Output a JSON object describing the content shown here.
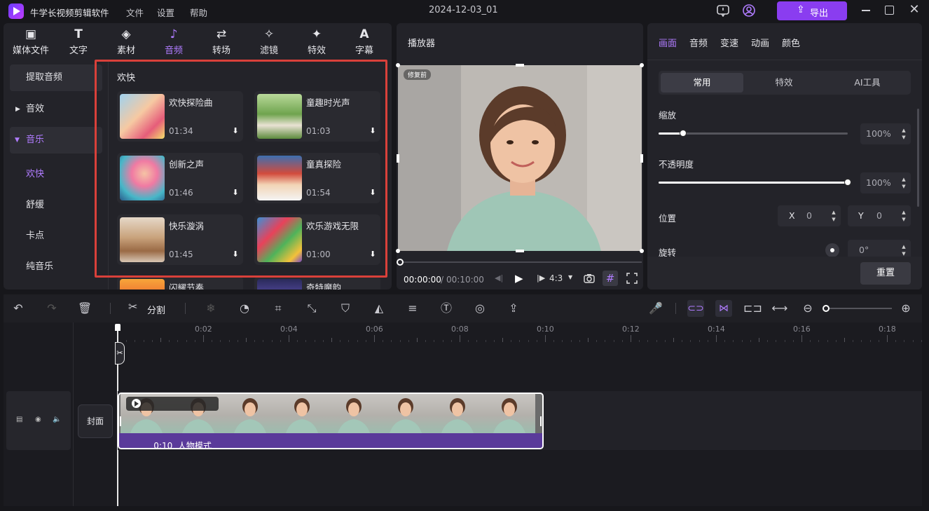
{
  "app": {
    "name": "牛学长视频剪辑软件",
    "project_title": "2024-12-03_01"
  },
  "menu": [
    "文件",
    "设置",
    "帮助"
  ],
  "export_label": "导出",
  "tool_tabs": [
    {
      "label": "媒体文件",
      "icon": "media-icon"
    },
    {
      "label": "文字",
      "icon": "text-icon"
    },
    {
      "label": "素材",
      "icon": "material-icon"
    },
    {
      "label": "音频",
      "icon": "music-note-icon"
    },
    {
      "label": "转场",
      "icon": "transition-icon"
    },
    {
      "label": "滤镜",
      "icon": "filter-icon"
    },
    {
      "label": "特效",
      "icon": "effects-icon"
    },
    {
      "label": "字幕",
      "icon": "subtitle-icon"
    }
  ],
  "sidebar": {
    "extract": "提取音频",
    "sound_effects": "音效",
    "music": "音乐",
    "music_sub": [
      "欢快",
      "舒缓",
      "卡点",
      "纯音乐"
    ]
  },
  "library": {
    "heading": "欢快",
    "tracks": [
      {
        "title": "欢快探险曲",
        "duration": "01:34"
      },
      {
        "title": "童趣时光声",
        "duration": "01:03"
      },
      {
        "title": "创新之声",
        "duration": "01:46"
      },
      {
        "title": "童真探险",
        "duration": "01:54"
      },
      {
        "title": "快乐漩涡",
        "duration": "01:45"
      },
      {
        "title": "欢乐游戏无限",
        "duration": "01:00"
      },
      {
        "title": "闪耀节奏",
        "duration": ""
      },
      {
        "title": "奇特魔韵",
        "duration": ""
      }
    ]
  },
  "player": {
    "title": "播放器",
    "badge": "修复前",
    "current_time": "00:00:00",
    "separator": "/",
    "total_time": "00:10:00",
    "aspect": "4:3"
  },
  "properties": {
    "tabs": [
      "画面",
      "音频",
      "变速",
      "动画",
      "颜色"
    ],
    "subtabs": [
      "常用",
      "特效",
      "AI工具"
    ],
    "scale_label": "缩放",
    "scale_value": "100%",
    "scale_fraction": 0.13,
    "opacity_label": "不透明度",
    "opacity_value": "100%",
    "opacity_fraction": 1.0,
    "position_label": "位置",
    "x_label": "X",
    "x_value": "0",
    "y_label": "Y",
    "y_value": "0",
    "rotation_label": "旋转",
    "rotation_value": "0°",
    "reset_label": "重置"
  },
  "toolbar": {
    "split_label": "分割"
  },
  "timeline": {
    "ticks": [
      "0:02",
      "0:04",
      "0:06",
      "0:08",
      "0:10",
      "0:12",
      "0:14",
      "0:16",
      "0:18"
    ],
    "cover_label": "封面",
    "clip_label": "0:10  人物模式"
  },
  "colors": {
    "accent": "#b07cff",
    "export": "#8a3df0",
    "highlight_border": "#d9403a",
    "clip_audio": "#5a3a9a"
  }
}
